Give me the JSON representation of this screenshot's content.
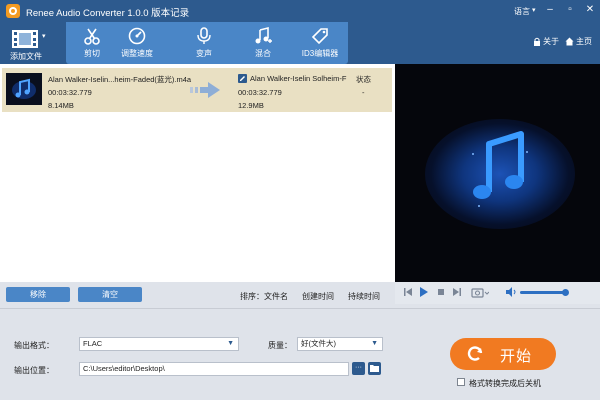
{
  "app": {
    "title": "Renee Audio Converter 1.0.0 版本记录",
    "language": "语言"
  },
  "toolbar": {
    "add_file": "添加文件",
    "tools": [
      {
        "label": "剪切",
        "icon": "scissors-icon"
      },
      {
        "label": "调整速度",
        "icon": "speed-gauge-icon"
      },
      {
        "label": "变声",
        "icon": "microphone-icon"
      },
      {
        "label": "混合",
        "icon": "music-mix-icon"
      },
      {
        "label": "ID3编辑器",
        "icon": "tag-edit-icon"
      }
    ],
    "about": "关于",
    "home": "主页"
  },
  "file_list": {
    "items": [
      {
        "source_name": "Alan Walker-Iselin...heim-Faded(蓝光).m4a",
        "source_duration": "00:03:32.779",
        "source_size": "8.14MB",
        "output_name": "Alan Walker-Iselin Solheim-F",
        "output_duration": "00:03:32.779",
        "output_size": "12.9MB",
        "status_header": "状态",
        "status_value": "-"
      }
    ]
  },
  "list_footer": {
    "remove": "移除",
    "clear": "清空",
    "sort_label": "排序：",
    "sort_options": [
      "文件名",
      "创建时间",
      "持续时间"
    ]
  },
  "output": {
    "format_label": "输出格式：",
    "format_value": "FLAC",
    "quality_label": "质量：",
    "quality_value": "好(文件大)",
    "location_label": "输出位置：",
    "location_value": "C:\\Users\\editor\\Desktop\\",
    "browse_glyph": "···"
  },
  "start": {
    "label": "开始",
    "shutdown_label": "格式转换完成后关机"
  },
  "colors": {
    "titlebar": "#2d5a8e",
    "tools_panel": "#4a86c7",
    "selected_row": "#e9e0c3",
    "start_button": "#f17a21"
  }
}
